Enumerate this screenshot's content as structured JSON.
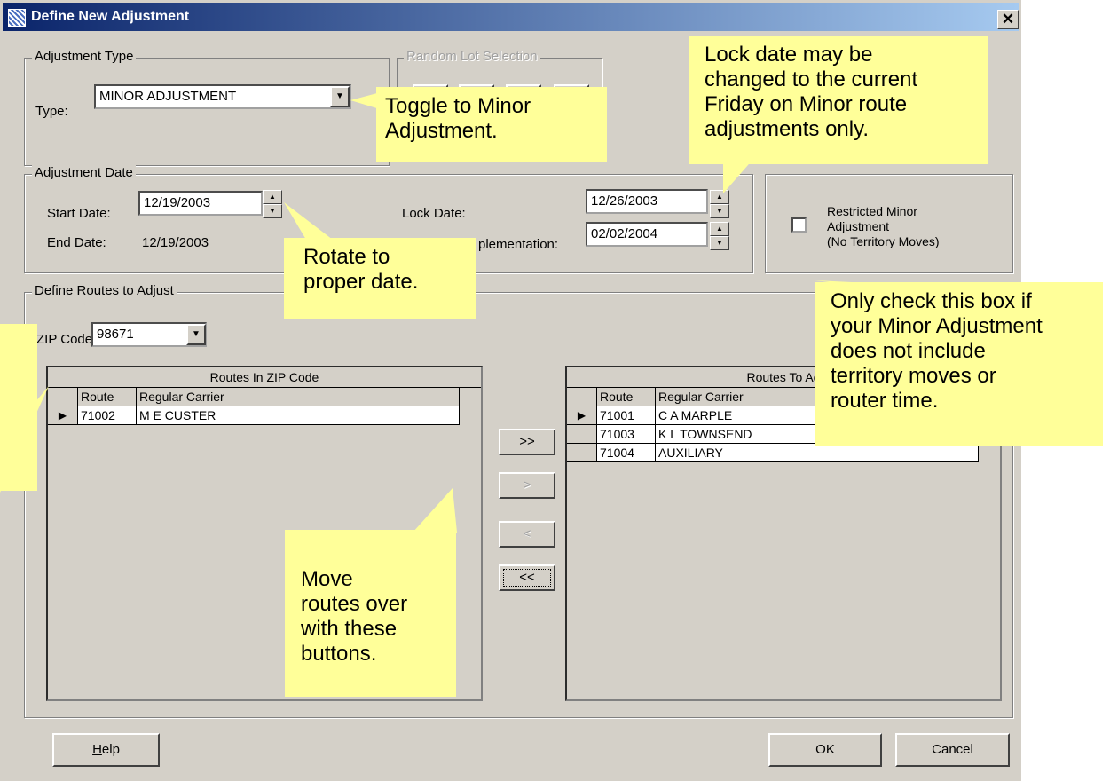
{
  "window": {
    "title": "Define New Adjustment",
    "close_glyph": "✕"
  },
  "adjustment_type": {
    "group_label": "Adjustment Type",
    "type_label": "Type:",
    "type_value": "MINOR ADJUSTMENT"
  },
  "random_lot": {
    "group_label": "Random Lot Selection"
  },
  "adjustment_date": {
    "group_label": "Adjustment Date",
    "start_label": "Start Date:",
    "start_value": "12/19/2003",
    "end_label": "End Date:",
    "end_value": "12/19/2003",
    "lock_label": "Lock Date:",
    "lock_value": "12/26/2003",
    "impl_label": "plementation:",
    "impl_value": "02/02/2004"
  },
  "restricted": {
    "label_lines": [
      "Restricted Minor",
      "Adjustment",
      "(No Territory Moves)"
    ]
  },
  "routes": {
    "group_label": "Define Routes to Adjust",
    "zip_label": "ZIP Code:",
    "zip_value": "98671",
    "left_grid": {
      "caption": "Routes In ZIP Code",
      "headers": [
        "Route",
        "Regular Carrier"
      ],
      "rows": [
        [
          "71002",
          "M E CUSTER"
        ]
      ]
    },
    "right_grid": {
      "caption": "Routes To Ad",
      "headers": [
        "Route",
        "Regular Carrier"
      ],
      "rows": [
        [
          "71001",
          "C A MARPLE"
        ],
        [
          "71003",
          "K L TOWNSEND"
        ],
        [
          "71004",
          "AUXILIARY"
        ]
      ]
    },
    "buttons": {
      "add_all": ">>",
      "add": ">",
      "remove": "<",
      "remove_all": "<<"
    }
  },
  "footer": {
    "help": "Help",
    "ok": "OK",
    "cancel": "Cancel"
  },
  "callouts": {
    "toggle": [
      "Toggle to Minor",
      "Adjustment."
    ],
    "lock": [
      "Lock date may be",
      "changed to the current",
      "Friday on Minor route",
      "adjustments only."
    ],
    "rotate": [
      "Rotate to",
      "proper date."
    ],
    "check": [
      "Only check this box if",
      "your Minor Adjustment",
      "does not include",
      "territory moves or",
      "router time."
    ],
    "move": [
      "Move",
      "routes over",
      "with these",
      "buttons."
    ]
  },
  "colors": {
    "callout_bg": "#ffff99",
    "dialog_bg": "#d4d0c8",
    "title_start": "#0a246a",
    "title_end": "#a6caf0"
  }
}
